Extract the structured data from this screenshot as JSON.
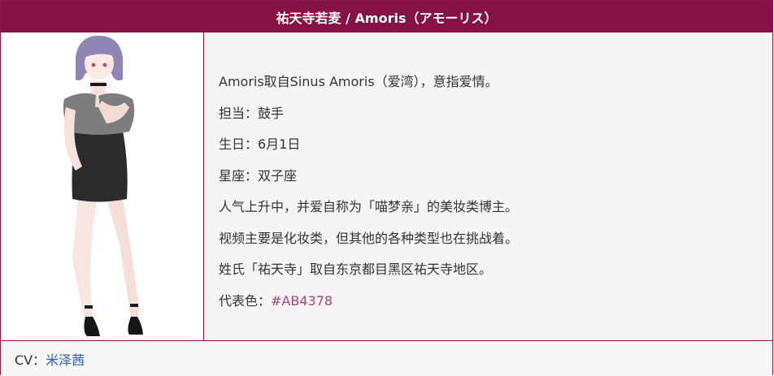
{
  "header": {
    "title": "祐天寺若麦 / Amoris（アモーリス）"
  },
  "colors": {
    "header_bg": "#861144",
    "border": "#8b1a45",
    "representative": "#AB4378",
    "link": "#2a63b8"
  },
  "portrait": {
    "icon": "character-illustration"
  },
  "info": {
    "lines": [
      "Amoris取自Sinus Amoris（爱湾），意指爱情。",
      "担当：鼓手",
      "生日：6月1日",
      "星座：双子座",
      "人气上升中，并爱自称为「喵梦亲」的美妆类博主。",
      "视频主要是化妆类，但其他的各种类型也在挑战着。",
      "姓氏「祐天寺」取自东京都目黑区祐天寺地区。"
    ],
    "color_label": "代表色：",
    "color_value": "#AB4378"
  },
  "cv": {
    "label": "CV：",
    "name": "米泽茜"
  }
}
